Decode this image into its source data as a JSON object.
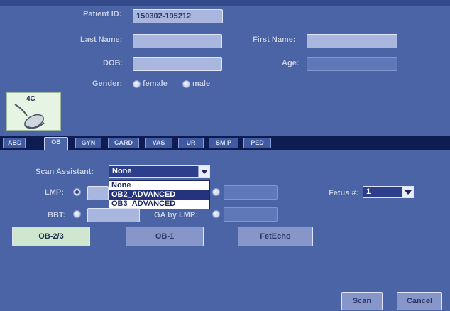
{
  "patient": {
    "patient_id_label": "Patient ID:",
    "patient_id_value": "150302-195212",
    "last_name_label": "Last Name:",
    "first_name_label": "First Name:",
    "dob_label": "DOB:",
    "age_label": "Age:",
    "gender_label": "Gender:",
    "gender_options": [
      "female",
      "male"
    ]
  },
  "probe": {
    "label": "4C",
    "icon": "probe-icon"
  },
  "tabs": [
    {
      "label": "ABD"
    },
    {
      "label": "OB"
    },
    {
      "label": "GYN"
    },
    {
      "label": "CARD"
    },
    {
      "label": "VAS"
    },
    {
      "label": "UR"
    },
    {
      "label": "SM P"
    },
    {
      "label": "PED"
    }
  ],
  "active_tab": "OB",
  "ob": {
    "scan_assistant_label": "Scan Assistant:",
    "scan_assistant_value": "None",
    "scan_assistant_options": [
      "None",
      "OB2_ADVANCED",
      "OB3_ADVANCED"
    ],
    "highlighted_option": "OB2_ADVANCED",
    "lmp_label": "LMP:",
    "bbt_label": "BBT:",
    "ga_by_lmp_label": "GA by LMP:",
    "fetus_label": "Fetus #:",
    "fetus_value": "1"
  },
  "buttons": {
    "ob23": "OB-2/3",
    "ob1": "OB-1",
    "fetecho": "FetEcho",
    "scan": "Scan",
    "cancel": "Cancel"
  },
  "colors": {
    "background": "#4a64a6",
    "tabbar": "#0e1c52",
    "highlight": "#25327e",
    "probe_bg": "#e6f4e4"
  }
}
